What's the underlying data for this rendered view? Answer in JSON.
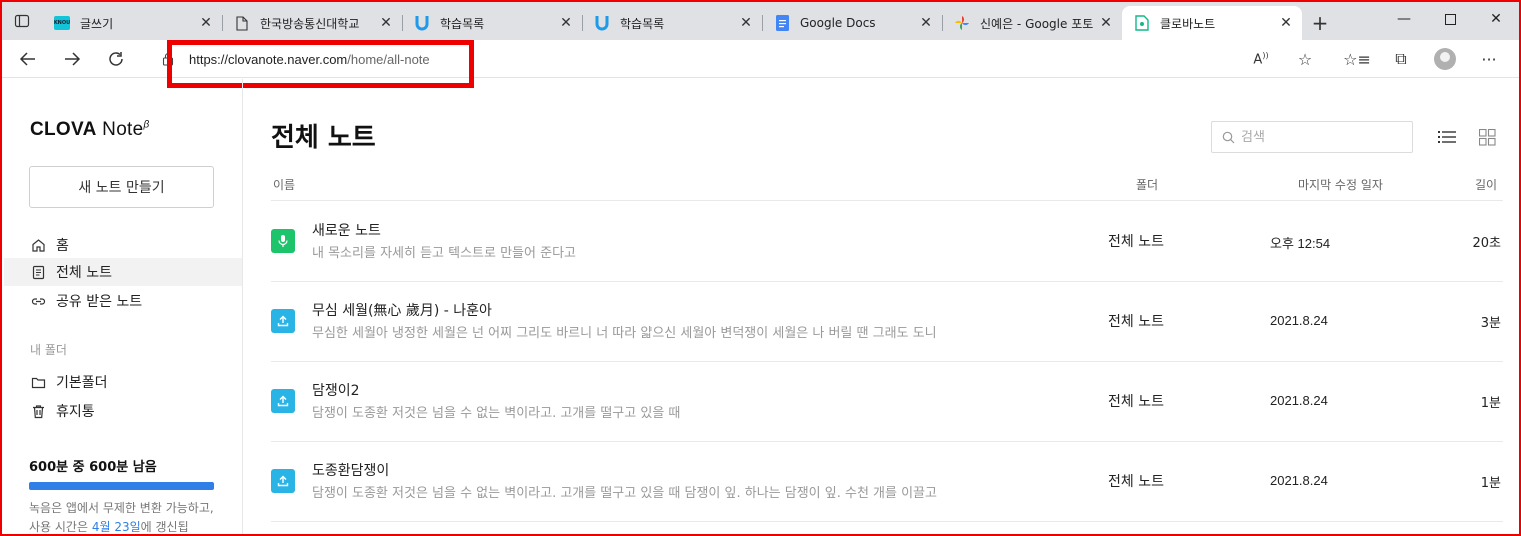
{
  "browser": {
    "tabs": [
      {
        "title": "글쓰기",
        "icon": "knou-icon",
        "icon_text": "KNOU",
        "active": false
      },
      {
        "title": "한국방송통신대학교",
        "icon": "page-icon",
        "active": false
      },
      {
        "title": "학습목록",
        "icon": "u-logo-icon",
        "active": false
      },
      {
        "title": "학습목록",
        "icon": "u-logo-icon",
        "active": false
      },
      {
        "title": "Google Docs",
        "icon": "docs-icon",
        "active": false
      },
      {
        "title": "신예은 - Google 포토",
        "icon": "photos-icon",
        "active": false
      },
      {
        "title": "클로바노트",
        "icon": "clova-note-icon",
        "active": true
      }
    ],
    "url_main": "https://clovanote.naver.com",
    "url_path": "/home/all-note"
  },
  "sidebar": {
    "logo_bold": "CLOVA",
    "logo_light": " Note",
    "logo_beta": "β",
    "new_note_label": "새 노트 만들기",
    "nav": [
      {
        "label": "홈",
        "icon": "home-icon"
      },
      {
        "label": "전체 노트",
        "icon": "notes-icon"
      },
      {
        "label": "공유 받은 노트",
        "icon": "link-icon"
      }
    ],
    "folder_section_label": "내 폴더",
    "folders": [
      {
        "label": "기본폴더",
        "icon": "folder-icon"
      },
      {
        "label": "휴지통",
        "icon": "trash-icon"
      }
    ],
    "usage_label": "600분 중 600분 남음",
    "usage_fraction": 1.0,
    "usage_note_prefix": "녹음은 앱에서 무제한 변환 가능하고, 사용 시간은 ",
    "usage_note_link": "4월 23일",
    "usage_note_suffix": "에 갱신됩"
  },
  "main": {
    "title": "전체 노트",
    "search_placeholder": "검색",
    "columns": {
      "name": "이름",
      "folder": "폴더",
      "modified": "마지막 수정 일자",
      "length": "길이"
    },
    "notes": [
      {
        "title": "새로운 노트",
        "preview": "내 목소리를 자세히 듣고 텍스트로 만들어 준다고",
        "folder": "전체 노트",
        "date": "오후 12:54",
        "length": "20초",
        "type": "mic"
      },
      {
        "title": "무심 세월(無心 歲月) - 나훈아",
        "preview": "무심한 세월아 냉정한 세월은 넌 어찌 그리도 바르니 너 따라 얇으신 세월아 변덕쟁이 세월은 나 버릴 땐 그래도 도니",
        "folder": "전체 노트",
        "date": "2021.8.24",
        "length": "3분",
        "type": "upload"
      },
      {
        "title": "담쟁이2",
        "preview": "담쟁이 도종환 저것은 넘을 수 없는 벽이라고. 고개를 떨구고 있을 때",
        "folder": "전체 노트",
        "date": "2021.8.24",
        "length": "1분",
        "type": "upload"
      },
      {
        "title": "도종환담쟁이",
        "preview": "담쟁이 도종환 저것은 넘을 수 없는 벽이라고. 고개를 떨구고 있을 때 담쟁이 잎. 하나는 담쟁이 잎. 수천 개를 이끌고",
        "folder": "전체 노트",
        "date": "2021.8.24",
        "length": "1분",
        "type": "upload"
      }
    ]
  },
  "colors": {
    "accent": "#2f7fe6",
    "mic_badge": "#1ec46b",
    "upload_badge": "#2ab4e6",
    "highlight": "#e00000"
  }
}
